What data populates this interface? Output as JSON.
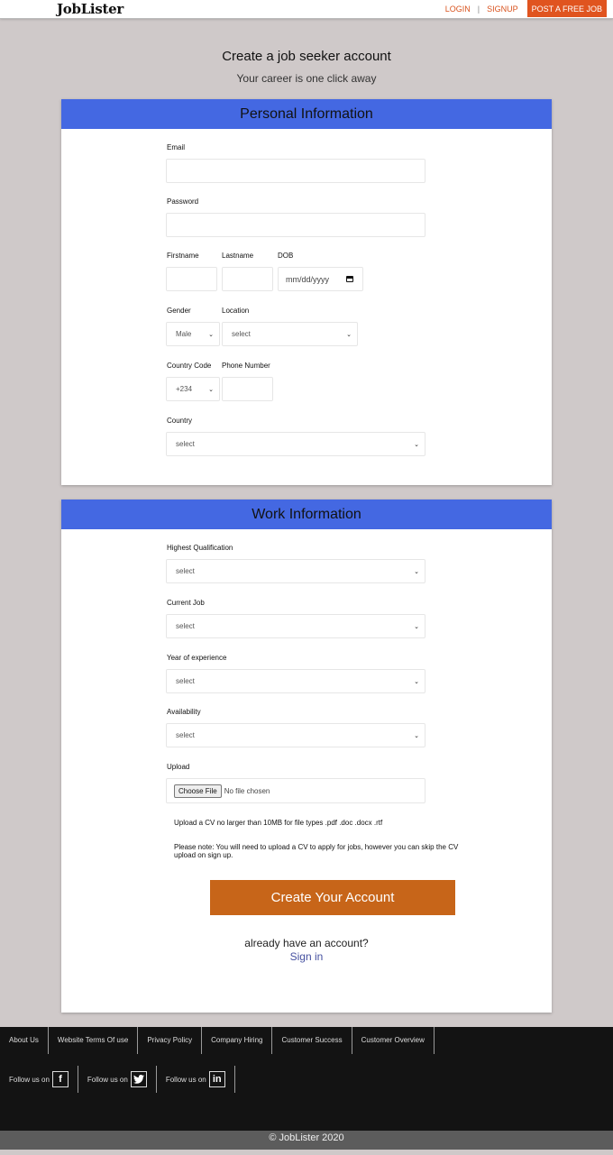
{
  "header": {
    "logo": "JobLister",
    "login": "LOGIN",
    "separator": "|",
    "signup": "SIGNUP",
    "post_job": "POST A FREE JOB"
  },
  "intro": {
    "title": "Create a job seeker account",
    "subtitle": "Your career is one click away"
  },
  "personal": {
    "heading": "Personal Information",
    "email_label": "Email",
    "password_label": "Password",
    "firstname_label": "Firstname",
    "lastname_label": "Lastname",
    "dob_label": "DOB",
    "dob_placeholder": "mm/dd/yyyy",
    "gender_label": "Gender",
    "gender_value": "Male",
    "location_label": "Location",
    "location_value": "select",
    "country_code_label": "Country Code",
    "country_code_value": "+234",
    "phone_label": "Phone Number",
    "country_label": "Country",
    "country_value": "select"
  },
  "work": {
    "heading": "Work Information",
    "qualification_label": "Highest Qualification",
    "qualification_value": "select",
    "current_job_label": "Current Job",
    "current_job_value": "select",
    "experience_label": "Year of experience",
    "experience_value": "select",
    "availability_label": "Availability",
    "availability_value": "select",
    "upload_label": "Upload",
    "choose_file": "Choose File",
    "no_file": "No file chosen",
    "upload_note": "Upload a CV no larger than 10MB for file types .pdf .doc .docx .rtf",
    "please_note": "Please note: You will need to upload a CV to apply for jobs, however you can skip the CV upload on sign up."
  },
  "actions": {
    "create_account": "Create Your Account",
    "already": "already have an account?",
    "sign_in": "Sign in"
  },
  "footer": {
    "links": [
      "About Us",
      "Website Terms Of use",
      "Privacy Policy",
      "Company Hiring",
      "Customer Success",
      "Customer Overview"
    ],
    "follow_text": "Follow us on",
    "social": [
      "f",
      "t",
      "in"
    ],
    "copyright": "© JobLister 2020"
  },
  "colors": {
    "accent": "#4468e2",
    "cta": "#c76519",
    "post_job": "#e0541f",
    "background": "#cfc9c9",
    "footer": "#131313"
  }
}
